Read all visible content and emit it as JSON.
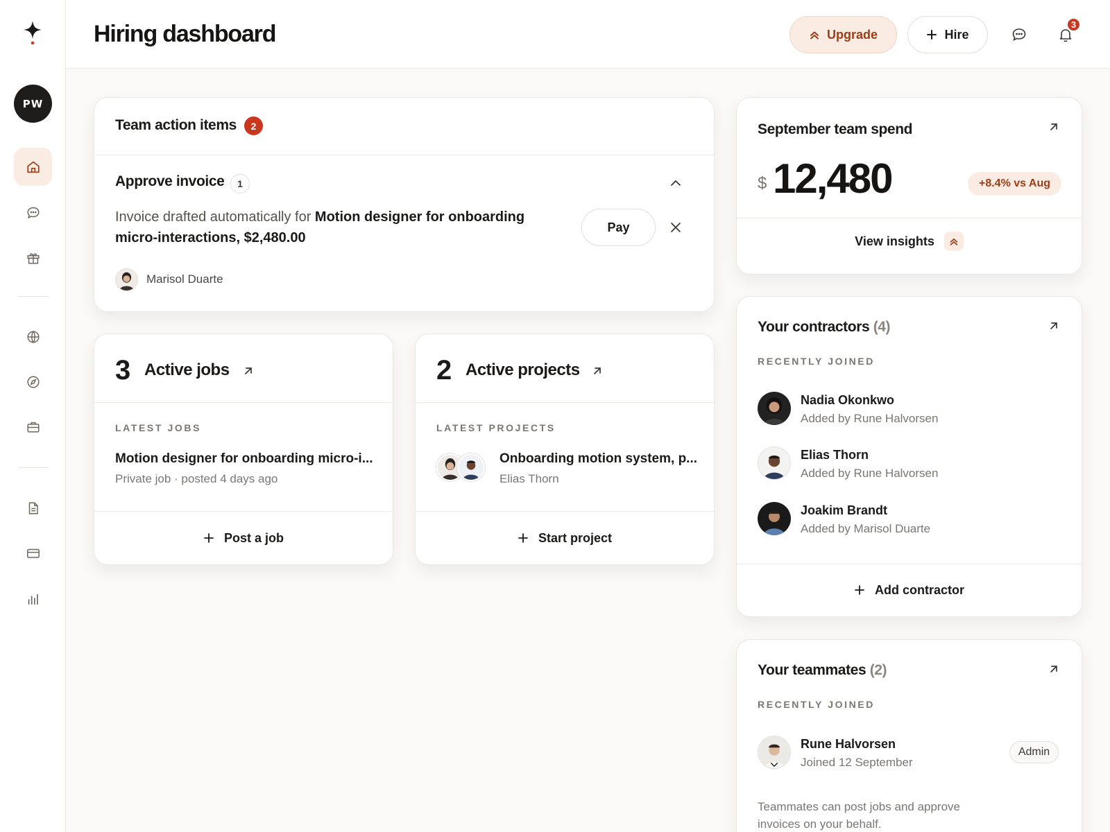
{
  "header": {
    "title": "Hiring dashboard",
    "upgrade_label": "Upgrade",
    "hire_label": "Hire",
    "notification_count": "3"
  },
  "sidebar": {
    "avatar_initials": "PW",
    "items": [
      {
        "icon": "home-icon",
        "active": true
      },
      {
        "icon": "chat-icon"
      },
      {
        "icon": "gift-icon"
      },
      {
        "icon": "globe-icon"
      },
      {
        "icon": "compass-icon"
      },
      {
        "icon": "briefcase-icon"
      },
      {
        "icon": "document-icon"
      },
      {
        "icon": "card-icon"
      },
      {
        "icon": "bar-chart-icon"
      }
    ]
  },
  "action_items": {
    "title": "Team action items",
    "count": "2",
    "section_title": "Approve invoice",
    "section_count": "1",
    "invoice_prefix": "Invoice drafted automatically for ",
    "invoice_bold": "Motion designer for onboarding micro-interactions, $2,480.00",
    "pay_label": "Pay",
    "person": "Marisol Duarte"
  },
  "jobs": {
    "count": "3",
    "label": "Active jobs",
    "eyebrow": "LATEST JOBS",
    "latest_title": "Motion designer for onboarding micro-i...",
    "latest_meta": "Private job · posted 4 days ago",
    "action_label": "Post a job"
  },
  "projects": {
    "count": "2",
    "label": "Active projects",
    "eyebrow": "LATEST PROJECTS",
    "latest_title": "Onboarding motion system, p...",
    "latest_meta": "Elias Thorn",
    "action_label": "Start project"
  },
  "spend": {
    "title": "September team spend",
    "currency": "$",
    "amount": "12,480",
    "delta": "+8.4% vs Aug",
    "insights_label": "View insights"
  },
  "contractors": {
    "title": "Your contractors",
    "count": "(4)",
    "eyebrow": "RECENTLY JOINED",
    "people": [
      {
        "name": "Nadia Okonkwo",
        "sub": "Added by Rune Halvorsen"
      },
      {
        "name": "Elias Thorn",
        "sub": "Added by Rune Halvorsen"
      },
      {
        "name": "Joakim Brandt",
        "sub": "Added by Marisol Duarte"
      }
    ],
    "action_label": "Add contractor"
  },
  "teammates": {
    "title": "Your teammates",
    "count": "(2)",
    "eyebrow": "RECENTLY JOINED",
    "person_name": "Rune Halvorsen",
    "person_sub": "Joined 12 September",
    "role": "Admin",
    "note": "Teammates can post jobs and approve invoices on your behalf."
  },
  "colors": {
    "accent": "#9b3d17",
    "accent_bg": "#fbece3",
    "badge_red": "#c8371e"
  }
}
